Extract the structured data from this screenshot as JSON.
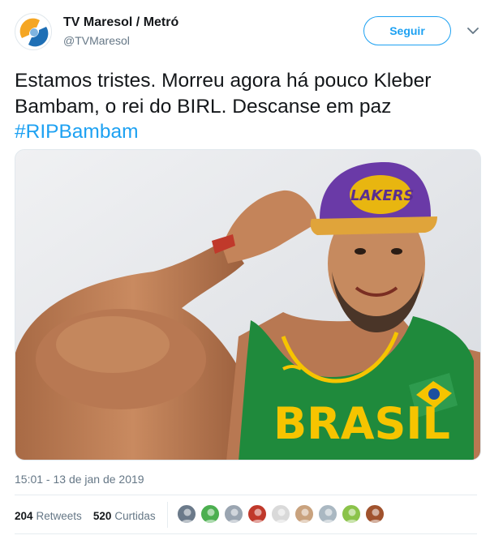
{
  "account": {
    "display_name": "TV Maresol / Metró",
    "handle": "@TVMaresol",
    "follow_label": "Seguir",
    "avatar_icon": "tv-maresol-logo-icon",
    "brand_colors": [
      "#f5a623",
      "#1e6fb5"
    ]
  },
  "tweet": {
    "text_before": "Estamos tristes. Morreu agora há pouco Kleber Bambam, o rei do BIRL. Descanse em paz ",
    "hashtag": "#RIPBambam",
    "media": {
      "cap_logo_text": "LAKERS",
      "jersey_text": "BRASIL"
    },
    "timestamp": "15:01 - 13 de jan de 2019"
  },
  "stats": {
    "retweets_count": "204",
    "retweets_label": "Retweets",
    "likes_count": "520",
    "likes_label": "Curtidas"
  },
  "likers": [
    {
      "icon": "user-avatar-icon",
      "color": "#6b7a8a"
    },
    {
      "icon": "user-avatar-icon",
      "color": "#4caf50"
    },
    {
      "icon": "user-avatar-icon",
      "color": "#9aa5b1"
    },
    {
      "icon": "user-avatar-icon",
      "color": "#c0392b"
    },
    {
      "icon": "user-avatar-icon",
      "color": "#d9d9d9"
    },
    {
      "icon": "user-avatar-icon",
      "color": "#c9a27e"
    },
    {
      "icon": "default-avatar-icon",
      "color": "#aab8c2"
    },
    {
      "icon": "user-avatar-icon",
      "color": "#8bc34a"
    },
    {
      "icon": "user-avatar-icon",
      "color": "#a0522d"
    }
  ],
  "colors": {
    "accent": "#1da1f2",
    "text": "#14171a",
    "secondary": "#657786"
  }
}
